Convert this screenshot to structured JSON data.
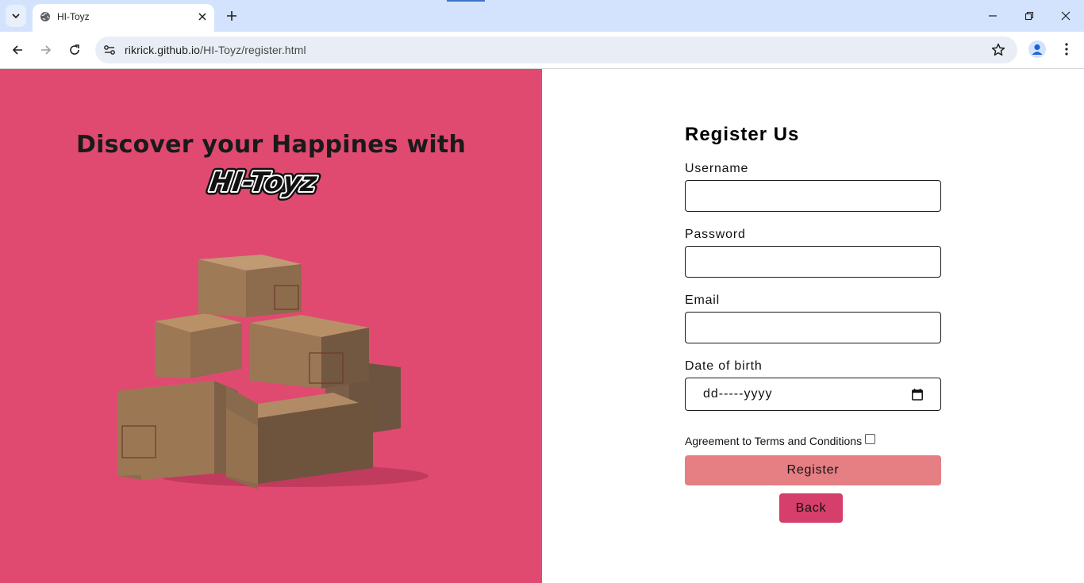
{
  "browser": {
    "tab_title": "HI-Toyz",
    "url_host": "rikrick.github.io",
    "url_path": "/HI-Toyz/register.html"
  },
  "hero": {
    "heading": "Discover your Happines with",
    "brand": "HI-Toyz",
    "background_color": "#e04a71"
  },
  "form": {
    "title": "Register Us",
    "username_label": "Username",
    "username_value": "",
    "password_label": "Password",
    "password_value": "",
    "email_label": "Email",
    "email_value": "",
    "dob_label": "Date of birth",
    "dob_placeholder": "dd-----yyyy",
    "agreement_label": "Agreement to Terms and Conditions",
    "agreement_checked": false,
    "register_label": "Register",
    "back_label": "Back"
  },
  "colors": {
    "register_button": "#e57f84",
    "back_button": "#d63f6b"
  }
}
